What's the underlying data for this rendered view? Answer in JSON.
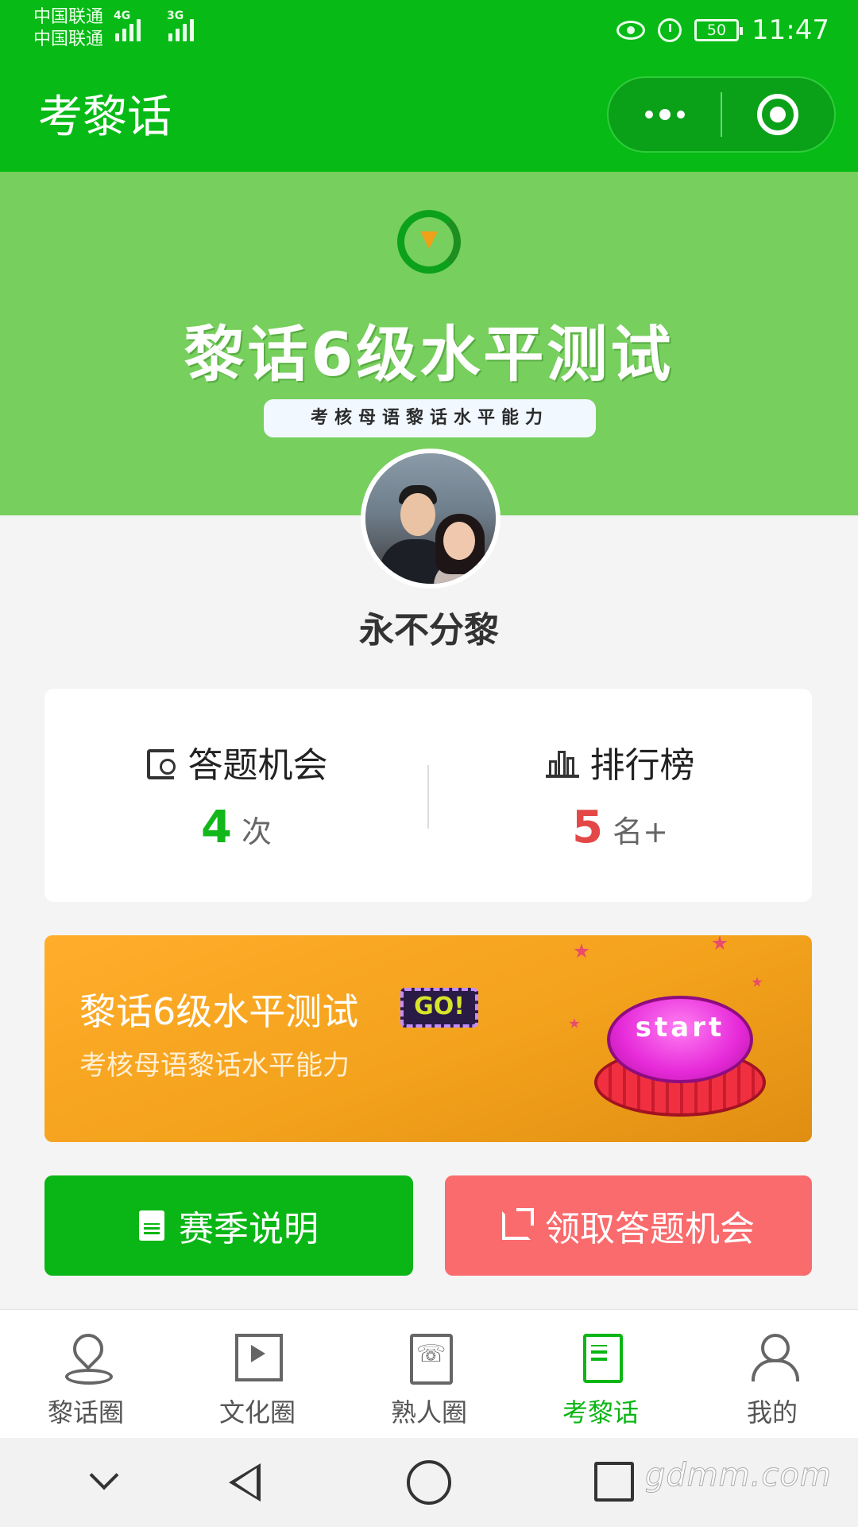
{
  "status_bar": {
    "carrier_1": "中国联通",
    "carrier_2": "中国联通",
    "net_1": "4G",
    "net_2": "3G",
    "battery": "50",
    "time": "11:47"
  },
  "header": {
    "title": "考黎话",
    "more_icon": "more-dots-icon",
    "close_icon": "target-circle-icon",
    "background_color": "#07ba16"
  },
  "banner": {
    "title": "黎话6级水平测试",
    "tagline": "考核母语黎话水平能力",
    "background_color": "#77cf5d"
  },
  "profile": {
    "username": "永不分黎"
  },
  "stats": {
    "answer_chances": {
      "label": "答题机会",
      "value": "4",
      "unit": "次",
      "icon": "book-search-icon"
    },
    "ranking": {
      "label": "排行榜",
      "value": "5",
      "unit": "名+",
      "icon": "podium-icon"
    }
  },
  "promo": {
    "title": "黎话6级水平测试",
    "badge": "GO!",
    "subtitle": "考核母语黎话水平能力",
    "button_text": "start"
  },
  "actions": {
    "season_label": "赛季说明",
    "claim_label": "领取答题机会"
  },
  "tabbar": {
    "items": [
      {
        "label": "黎话圈",
        "icon": "location-pin-icon",
        "active": false
      },
      {
        "label": "文化圈",
        "icon": "video-play-icon",
        "active": false
      },
      {
        "label": "熟人圈",
        "icon": "phone-book-icon",
        "active": false
      },
      {
        "label": "考黎话",
        "icon": "exam-paper-icon",
        "active": true
      },
      {
        "label": "我的",
        "icon": "user-icon",
        "active": false
      }
    ],
    "active_color": "#0ab615"
  },
  "watermark": "gdmm.com"
}
